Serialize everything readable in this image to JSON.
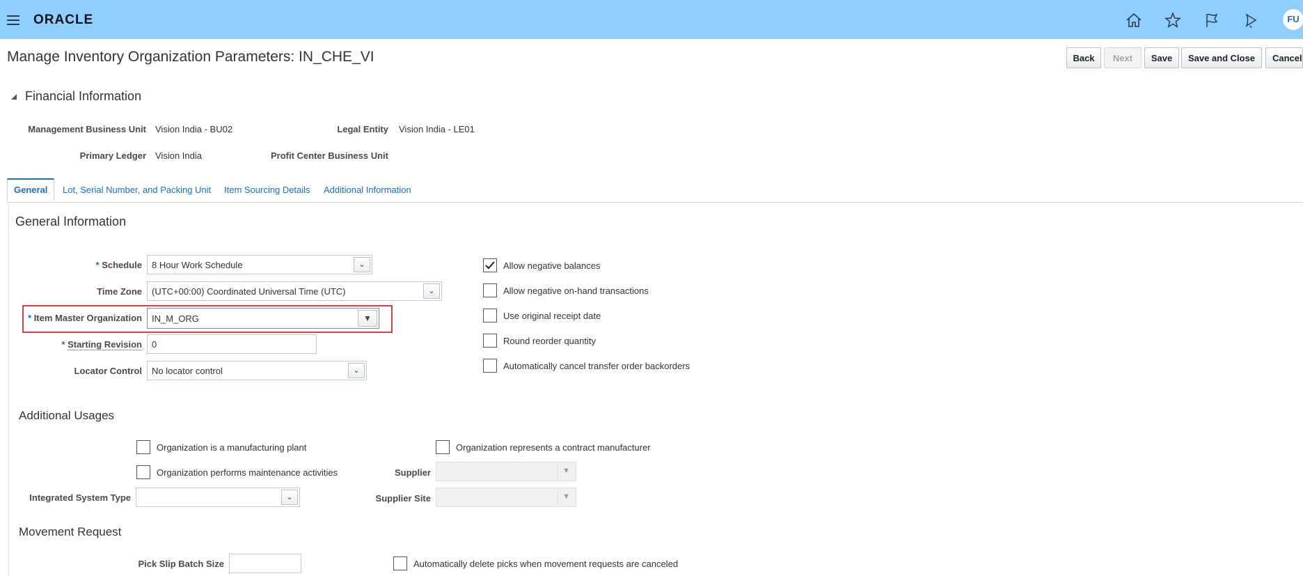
{
  "header": {
    "logo": "ORACLE",
    "avatar": "FU",
    "icons": [
      "home-icon",
      "star-icon",
      "flag-icon",
      "bell-icon"
    ]
  },
  "page": {
    "title": "Manage Inventory Organization Parameters: IN_CHE_VI"
  },
  "toolbar": {
    "back": "Back",
    "next": "Next",
    "save": "Save",
    "save_close": "Save and Close",
    "cancel": "Cancel"
  },
  "financial": {
    "heading": "Financial Information",
    "mbu_label": "Management Business Unit",
    "mbu_value": "Vision India - BU02",
    "le_label": "Legal Entity",
    "le_value": "Vision India - LE01",
    "ledger_label": "Primary Ledger",
    "ledger_value": "Vision India",
    "pcbu_label": "Profit Center Business Unit"
  },
  "tabs": [
    "General",
    "Lot, Serial Number, and Packing Unit",
    "Item Sourcing Details",
    "Additional Information"
  ],
  "general": {
    "heading": "General Information",
    "schedule_label": "Schedule",
    "schedule_value": "8 Hour Work Schedule",
    "timezone_label": "Time Zone",
    "timezone_value": "(UTC+00:00) Coordinated Universal Time (UTC)",
    "imo_label": "Item Master Organization",
    "imo_value": "IN_M_ORG",
    "rev_label": "Starting Revision",
    "rev_value": "0",
    "locator_label": "Locator Control",
    "locator_value": "No locator control",
    "required_mark": "*",
    "checks": [
      {
        "label": "Allow negative balances",
        "checked": true
      },
      {
        "label": "Allow negative on-hand transactions",
        "checked": false
      },
      {
        "label": "Use original receipt date",
        "checked": false
      },
      {
        "label": "Round reorder quantity",
        "checked": false
      },
      {
        "label": "Automatically cancel transfer order backorders",
        "checked": false
      }
    ]
  },
  "additional": {
    "heading": "Additional Usages",
    "mfg_plant": "Organization is a manufacturing plant",
    "contract_mfr": "Organization represents a contract manufacturer",
    "maintenance": "Organization performs maintenance activities",
    "supplier_label": "Supplier",
    "integrated_label": "Integrated System Type",
    "supplier_site_label": "Supplier Site"
  },
  "movement": {
    "heading": "Movement Request",
    "pick_slip_label": "Pick Slip Batch Size",
    "auto_delete": "Automatically delete picks when movement requests are canceled"
  }
}
